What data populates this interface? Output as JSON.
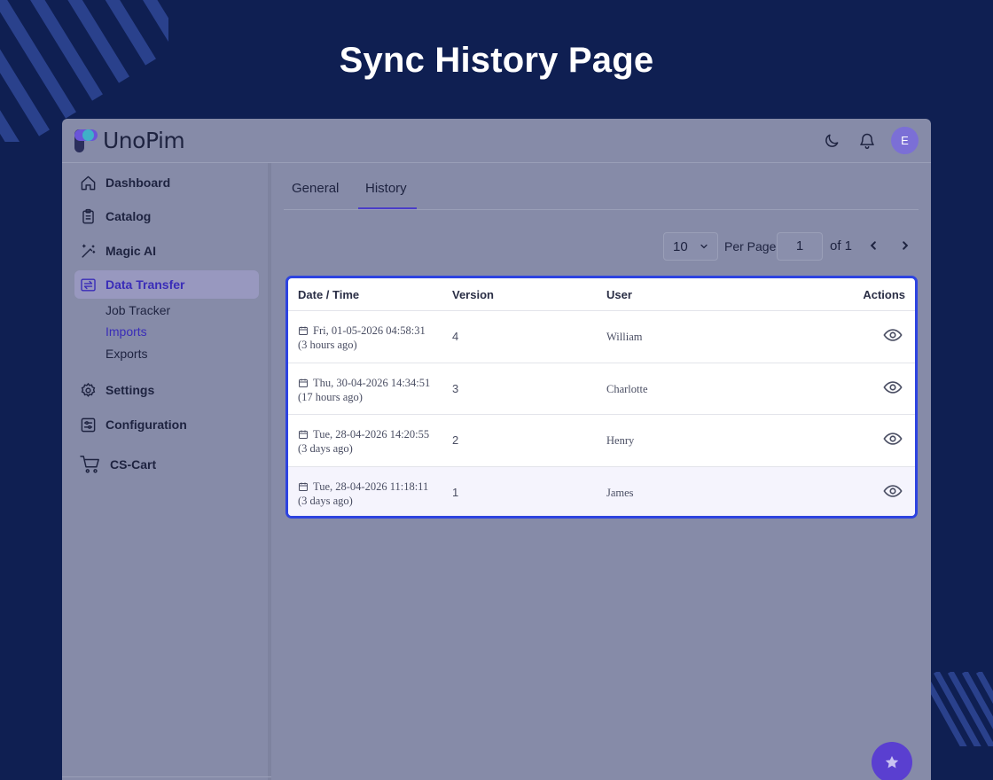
{
  "hero": {
    "title": "Sync History Page"
  },
  "brand": {
    "name": "UnoPim"
  },
  "header": {
    "avatar_initial": "E"
  },
  "sidebar": {
    "items": [
      {
        "label": "Dashboard",
        "icon": "home-icon"
      },
      {
        "label": "Catalog",
        "icon": "clipboard-icon"
      },
      {
        "label": "Magic AI",
        "icon": "magic-wand-icon"
      },
      {
        "label": "Data Transfer",
        "icon": "transfer-icon",
        "active": true
      },
      {
        "label": "Settings",
        "icon": "gear-icon"
      },
      {
        "label": "Configuration",
        "icon": "sliders-icon"
      },
      {
        "label": "CS-Cart",
        "icon": "cart-icon"
      }
    ],
    "sub_items": [
      {
        "label": "Job Tracker"
      },
      {
        "label": "Imports",
        "active": true
      },
      {
        "label": "Exports"
      }
    ]
  },
  "tabs": [
    {
      "label": "General"
    },
    {
      "label": "History",
      "active": true
    }
  ],
  "pagination": {
    "per_page": "10",
    "per_page_label": "Per Page",
    "current_page": "1",
    "total_label": "of 1"
  },
  "table": {
    "columns": [
      "Date / Time",
      "Version",
      "User",
      "Actions"
    ],
    "rows": [
      {
        "date": "Fri,  01-05-2026  04:58:31",
        "ago": "(3  hours  ago)",
        "version": "4",
        "user": "William"
      },
      {
        "date": "Thu,  30-04-2026  14:34:51",
        "ago": "(17  hours  ago)",
        "version": "3",
        "user": "Charlotte"
      },
      {
        "date": "Tue,  28-04-2026  14:20:55",
        "ago": "(3  days  ago)",
        "version": "2",
        "user": "Henry"
      },
      {
        "date": "Tue,  28-04-2026  11:18:11",
        "ago": "(3  days  ago)",
        "version": "1",
        "user": "James"
      }
    ]
  },
  "colors": {
    "background": "#0f1f52",
    "accent": "#2d43e0",
    "fab": "#5a3fd0"
  }
}
